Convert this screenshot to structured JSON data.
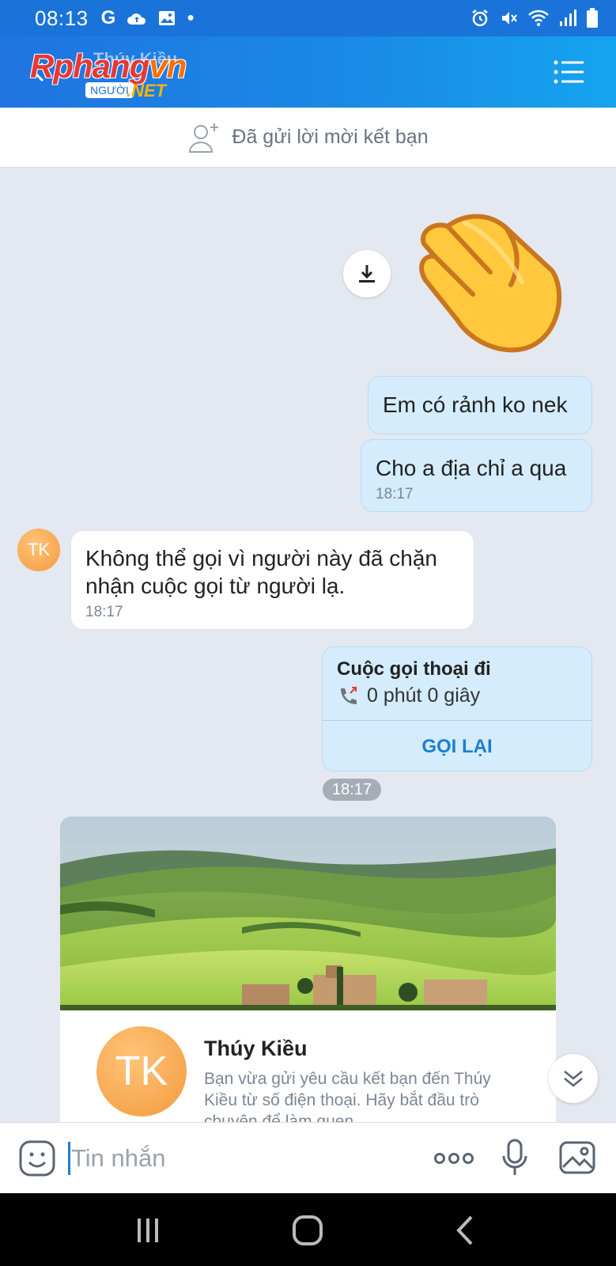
{
  "status_bar": {
    "time": "08:13",
    "left_icons": [
      "g-icon",
      "cloud-upload-icon",
      "image-icon",
      "dot-icon"
    ],
    "right_icons": [
      "alarm-icon",
      "mute-icon",
      "wifi-icon",
      "signal-icon",
      "battery-icon"
    ]
  },
  "header": {
    "title": "Thúy Kiều",
    "watermark": {
      "brand_part1": "Rphang",
      "brand_part2": "vn",
      "sub1": "NGƯỜI",
      "sub2": ".NET"
    }
  },
  "friend_request": {
    "text": "Đã gửi lời mời kết bạn"
  },
  "messages": [
    {
      "from": "me",
      "text": "Em có rảnh ko nek"
    },
    {
      "from": "me",
      "text": "Cho a địa chỉ a qua",
      "time": "18:17"
    },
    {
      "from": "them",
      "avatar": "TK",
      "line1": "Không thể gọi vì người này đã chặn",
      "line2": "nhận cuộc gọi từ người lạ.",
      "time": "18:17"
    }
  ],
  "call_card": {
    "title": "Cuộc gọi thoại đi",
    "duration": "0 phút 0 giây",
    "action": "GỌI LẠI"
  },
  "time_pill": "18:17",
  "profile_card": {
    "avatar": "TK",
    "name": "Thúy Kiều",
    "description": "Bạn vừa gửi yêu cầu kết bạn đến Thúy Kiều từ số điện thoại. Hãy bắt đầu trò chuyện để làm quen"
  },
  "composer": {
    "placeholder": "Tin nhắn"
  },
  "colors": {
    "accent": "#1a73d9",
    "bubble_me": "#d4ecfb",
    "avatar": "#f39b3c",
    "link": "#1a7fd1"
  }
}
